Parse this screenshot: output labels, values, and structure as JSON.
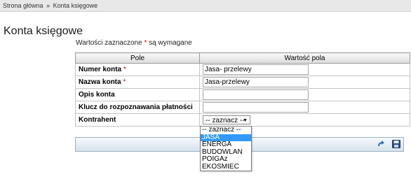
{
  "breadcrumb": {
    "home": "Strona główna",
    "separator": "»",
    "current": "Konta księgowe"
  },
  "page_title": "Konta księgowe",
  "required_note": {
    "text": "Wartości zaznaczone",
    "star": "*",
    "suffix": "są wymagane"
  },
  "table": {
    "headers": [
      "Pole",
      "Wartość pola"
    ],
    "rows": [
      {
        "label": "Numer konta",
        "required": true,
        "value": "Jasa- przelewy"
      },
      {
        "label": "Nazwa konta",
        "required": true,
        "value": "Jasa-przelewy"
      },
      {
        "label": "Opis konta",
        "required": false,
        "value": ""
      },
      {
        "label": "Klucz do rozpoznawania płatności",
        "required": false,
        "value": ""
      },
      {
        "label": "Kontrahent",
        "required": false,
        "select_value": "-- zaznacz --"
      }
    ]
  },
  "dropdown": {
    "options": [
      "-- zaznacz --",
      "JASA",
      "ENERGA",
      "BUDOWLAN",
      "POIGAz",
      "EKOSMIEC"
    ],
    "highlighted": "JASA"
  },
  "icons": {
    "undo": "undo-arrow-icon",
    "save": "floppy-disk-icon",
    "dropdown": "triangle-down-icon"
  },
  "colors": {
    "required_star": "#cc0000",
    "highlight": "#3399ff"
  }
}
